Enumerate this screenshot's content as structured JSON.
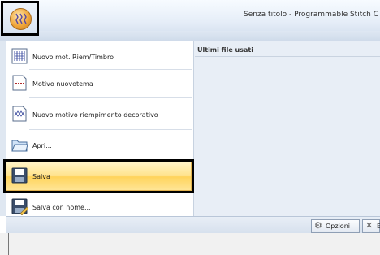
{
  "window": {
    "title": "Senza titolo - Programmable Stitch C"
  },
  "recent": {
    "header": "Ultimi file usati"
  },
  "menu": {
    "items": [
      {
        "label": "Nuovo mot. Riem/Timbro",
        "icon": "fill-stamp-pattern-icon"
      },
      {
        "label": "Motivo nuovotema",
        "icon": "new-motif-icon"
      },
      {
        "label": "Nuovo motivo riempimento decorativo",
        "icon": "decorative-fill-icon"
      },
      {
        "label": "Apri...",
        "icon": "open-folder-icon"
      },
      {
        "label": "Salva",
        "icon": "floppy-save-icon",
        "selected": true
      },
      {
        "label": "Salva con nome...",
        "icon": "floppy-save-as-icon"
      }
    ]
  },
  "footer": {
    "options_label": "Opzioni",
    "exit_label": "E"
  },
  "colors": {
    "highlight": "#ffe28a",
    "menu_bg": "#e9eef5",
    "title_bg": "#dbe5f2"
  }
}
